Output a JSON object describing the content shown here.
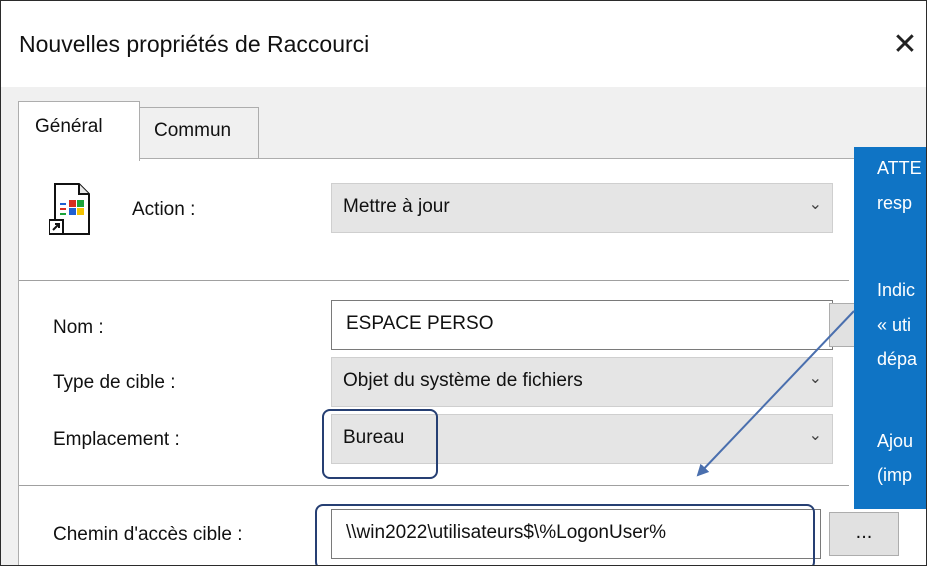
{
  "window": {
    "title": "Nouvelles propriétés de Raccourci",
    "close_glyph": "✕"
  },
  "tabs": [
    {
      "label": "Général",
      "active": true
    },
    {
      "label": "Commun",
      "active": false
    }
  ],
  "form": {
    "action_label": "Action :",
    "action_value": "Mettre à jour",
    "nom_label": "Nom :",
    "nom_value": "ESPACE PERSO",
    "type_label": "Type de cible :",
    "type_value": "Objet du système de fichiers",
    "emplacement_label": "Emplacement :",
    "emplacement_value": "Bureau",
    "chemin_label": "Chemin d'accès cible :",
    "chemin_value": "\\\\win2022\\utilisateurs$\\%LogonUser%",
    "browse_label": "...",
    "dropdown_chevron": "⌄"
  },
  "callout": {
    "lines": [
      "ATTE",
      "resp",
      "Indic",
      "« uti",
      "dépa",
      "Ajou",
      "(imp"
    ],
    "background": "#0f74c5",
    "text_color": "#ffffff"
  },
  "colors": {
    "highlight_border": "#263f73",
    "arrow": "#4a6fae"
  },
  "icons": {
    "shortcut": "shortcut-file-icon",
    "close": "close-icon",
    "chevron": "chevron-down-icon"
  }
}
